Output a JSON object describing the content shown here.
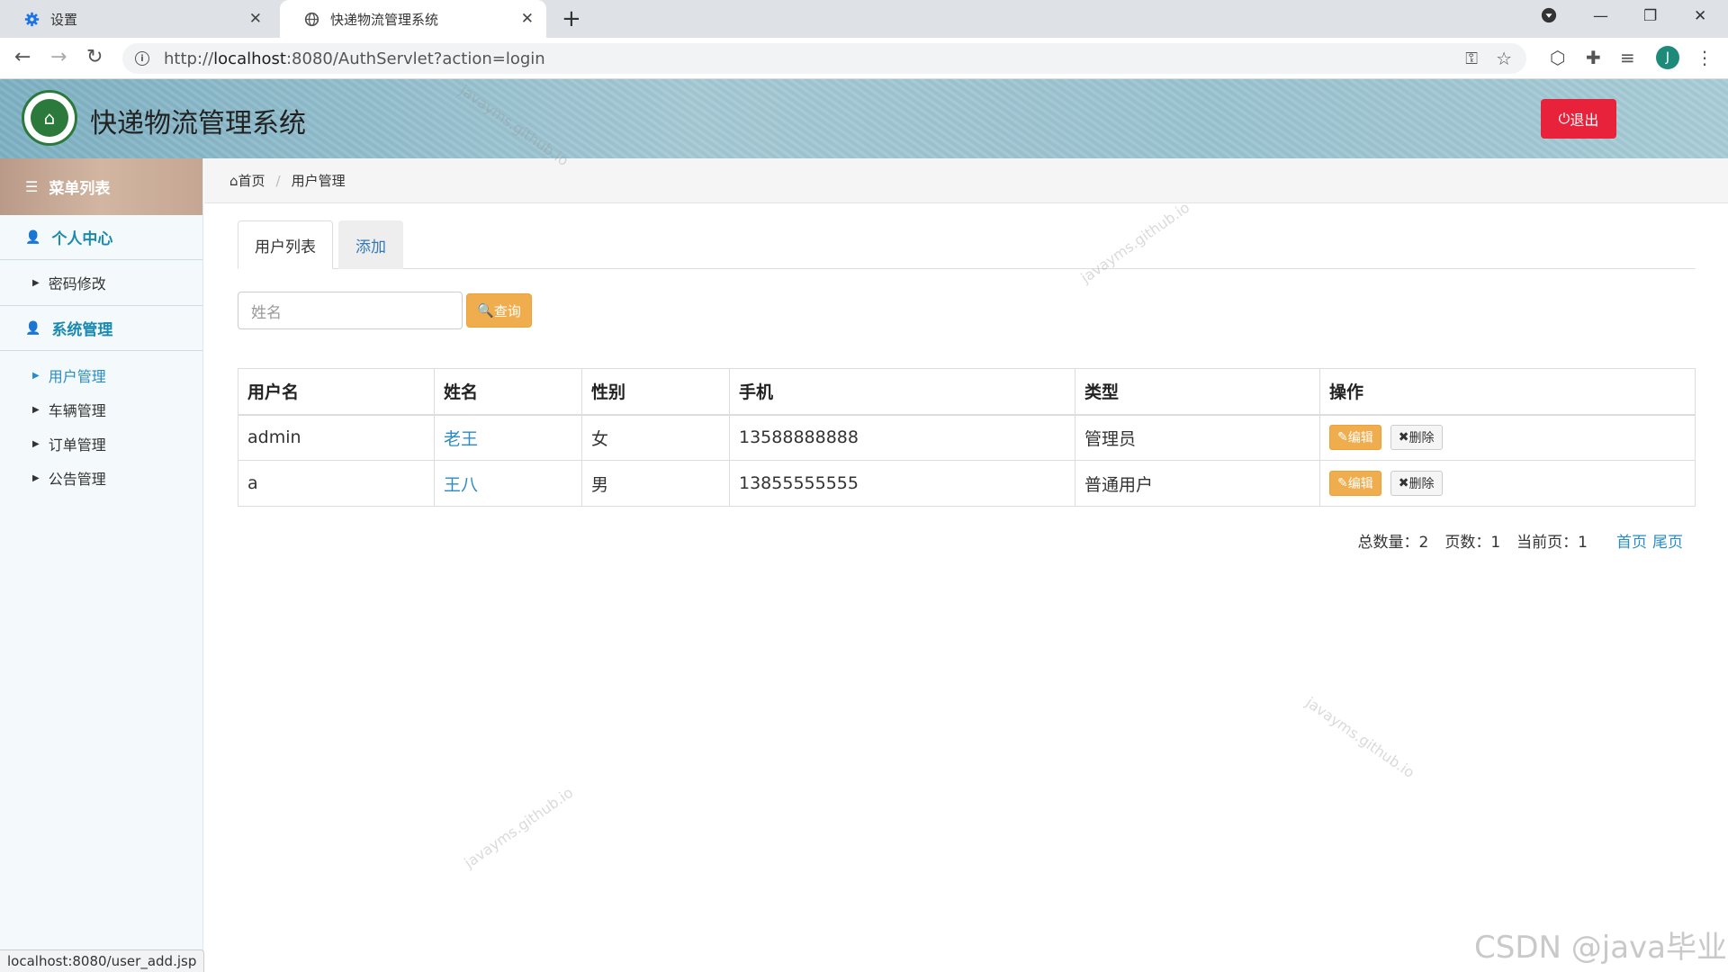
{
  "browser": {
    "tabs": [
      {
        "title": "设置",
        "icon": "gear-icon"
      },
      {
        "title": "快递物流管理系统",
        "icon": "globe-icon"
      }
    ],
    "url_prefix": "http://",
    "url_host": "localhost",
    "url_rest": ":8080/AuthServlet?action=login",
    "avatar_letter": "J",
    "status_url": "localhost:8080/user_add.jsp"
  },
  "header": {
    "title": "快递物流管理系统",
    "logout_label": "退出",
    "colors": {
      "logout": "#e8223a"
    }
  },
  "sidebar": {
    "title": "菜单列表",
    "groups": [
      {
        "label": "个人中心",
        "items": [
          {
            "label": "密码修改"
          }
        ]
      },
      {
        "label": "系统管理",
        "items": [
          {
            "label": "用户管理",
            "active": true
          },
          {
            "label": "车辆管理"
          },
          {
            "label": "订单管理"
          },
          {
            "label": "公告管理"
          }
        ]
      }
    ]
  },
  "breadcrumb": {
    "home": "首页",
    "current": "用户管理"
  },
  "main": {
    "tabs": [
      {
        "label": "用户列表"
      },
      {
        "label": "添加"
      }
    ],
    "search": {
      "placeholder": "姓名",
      "button": "查询"
    },
    "table": {
      "headers": [
        "用户名",
        "姓名",
        "性别",
        "手机",
        "类型",
        "操作"
      ],
      "rows": [
        {
          "username": "admin",
          "name": "老王",
          "gender": "女",
          "phone": "13588888888",
          "type": "管理员"
        },
        {
          "username": "a",
          "name": "王八",
          "gender": "男",
          "phone": "13855555555",
          "type": "普通用户"
        }
      ],
      "edit_label": "编辑",
      "delete_label": "删除"
    },
    "pager": {
      "total_label": "总数量：",
      "total": "2",
      "pages_label": "页数：",
      "pages": "1",
      "current_label": "当前页：",
      "current": "1",
      "first": "首页",
      "last": "尾页"
    }
  },
  "watermarks": {
    "text": "javayms.github.io",
    "csdn": "CSDN @java毕业"
  }
}
